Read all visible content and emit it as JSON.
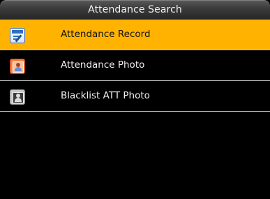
{
  "header": {
    "title": "Attendance Search"
  },
  "menu": {
    "items": [
      {
        "label": "Attendance Record",
        "icon": "attendance-record-icon",
        "selected": true
      },
      {
        "label": "Attendance Photo",
        "icon": "attendance-photo-icon",
        "selected": false
      },
      {
        "label": "Blacklist ATT Photo",
        "icon": "blacklist-photo-icon",
        "selected": false
      }
    ]
  },
  "colors": {
    "selected_background": "#ffb200",
    "screen_background": "#000000",
    "title_bar": "#3a3a3a",
    "divider": "#bdbdbd"
  }
}
